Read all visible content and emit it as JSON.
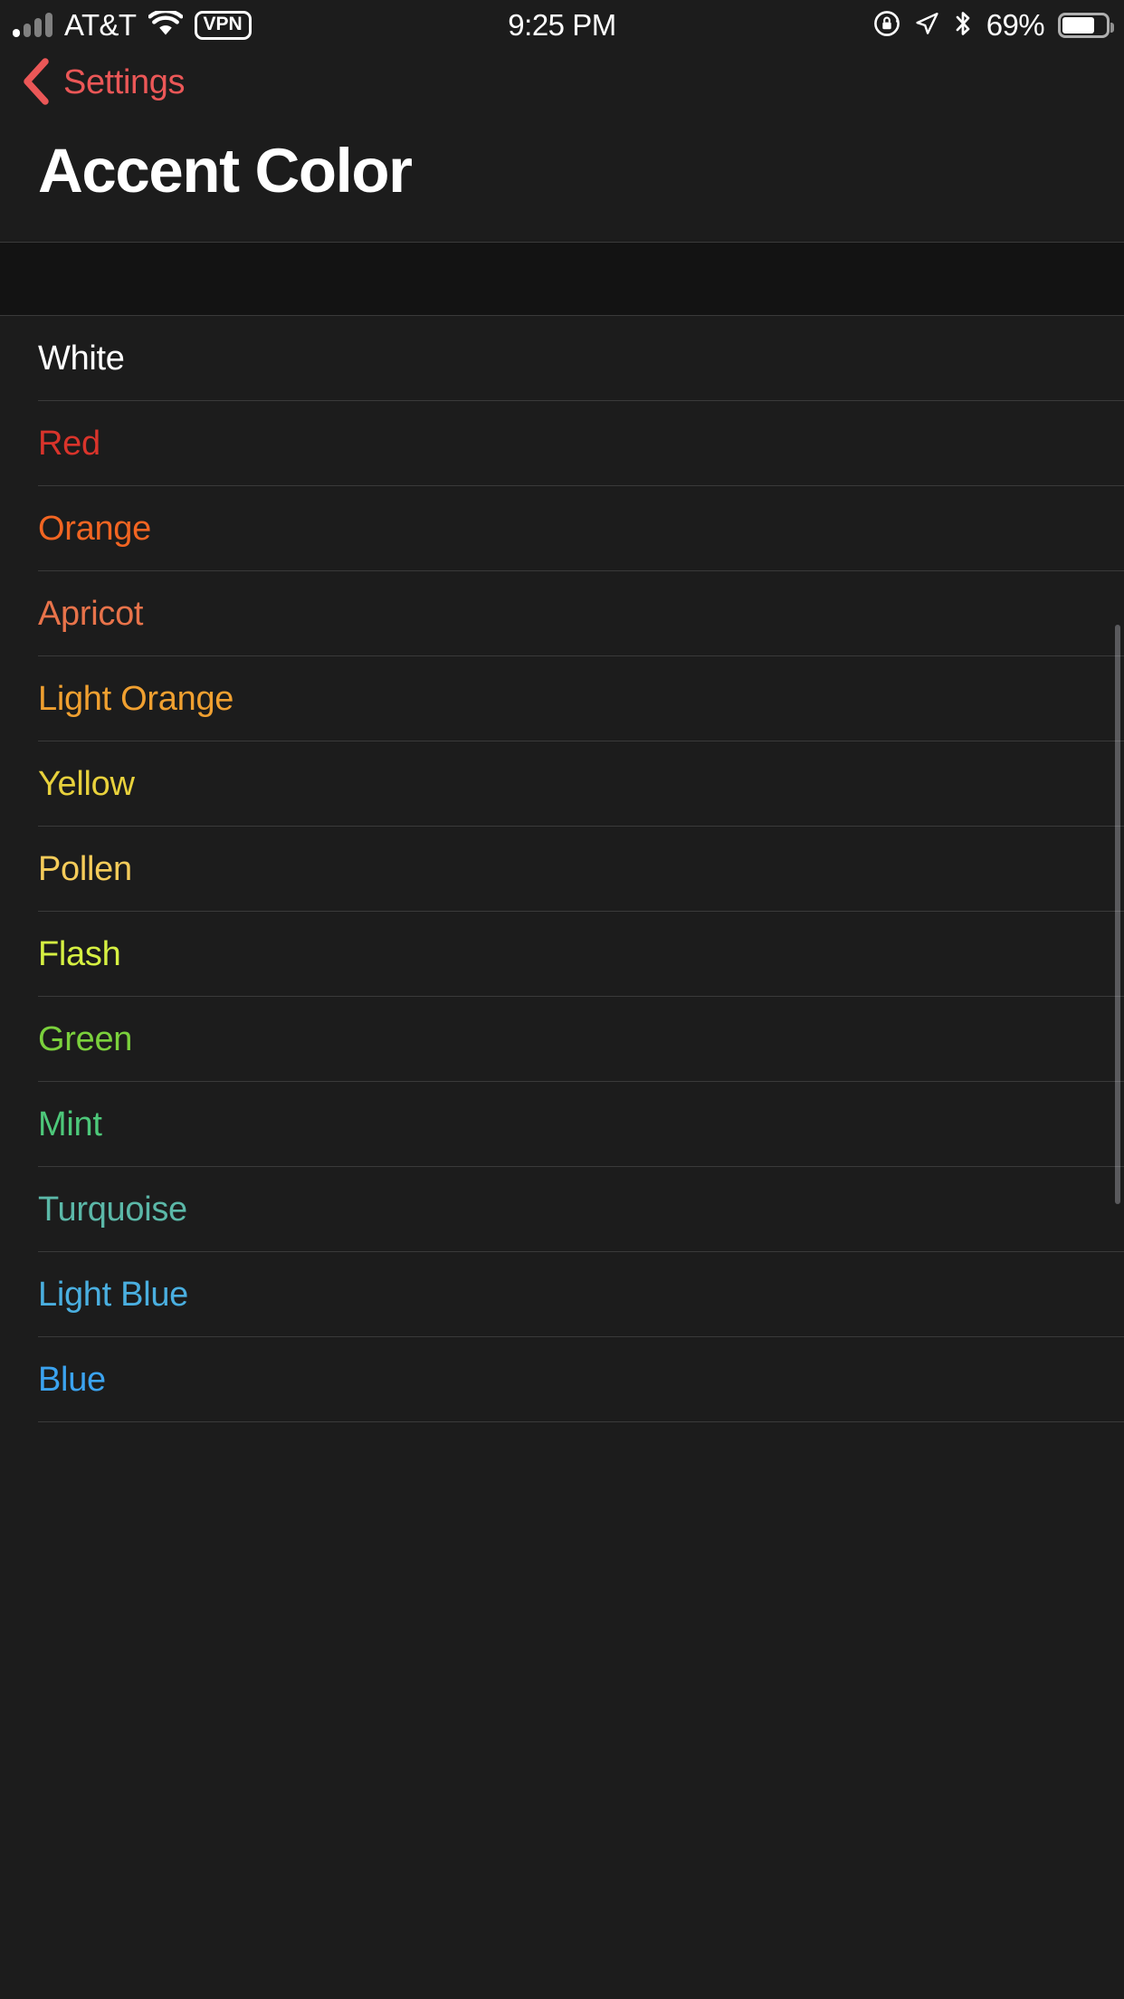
{
  "status_bar": {
    "carrier": "AT&T",
    "vpn_label": "VPN",
    "time": "9:25 PM",
    "battery_percent": "69%",
    "battery_level": 69,
    "signal_bars_total": 4,
    "signal_bars_active": 1,
    "icons": [
      "signal-bars-icon",
      "wifi-icon",
      "vpn-badge-icon",
      "rotation-lock-icon",
      "location-arrow-icon",
      "bluetooth-icon",
      "battery-icon"
    ]
  },
  "nav": {
    "back_label": "Settings",
    "back_icon": "chevron-left-icon",
    "tint_color": "#EB5757"
  },
  "header": {
    "title": "Accent Color"
  },
  "theme": {
    "background": "#1C1C1C",
    "group_gap_background": "#131313",
    "separator": "#3A3A3A",
    "title_color": "#FFFFFF"
  },
  "list": {
    "rows": [
      {
        "label": "White",
        "color": "#FFFFFF"
      },
      {
        "label": "Red",
        "color": "#D9342B"
      },
      {
        "label": "Orange",
        "color": "#F26522"
      },
      {
        "label": "Apricot",
        "color": "#E8734A"
      },
      {
        "label": "Light Orange",
        "color": "#F0A030"
      },
      {
        "label": "Yellow",
        "color": "#E8D13C"
      },
      {
        "label": "Pollen",
        "color": "#F5CC5A"
      },
      {
        "label": "Flash",
        "color": "#D6F042"
      },
      {
        "label": "Green",
        "color": "#7BD13C"
      },
      {
        "label": "Mint",
        "color": "#4DC87A"
      },
      {
        "label": "Turquoise",
        "color": "#5BB8A8"
      },
      {
        "label": "Light Blue",
        "color": "#4AAFE0"
      },
      {
        "label": "Blue",
        "color": "#3BA3F0"
      }
    ]
  }
}
